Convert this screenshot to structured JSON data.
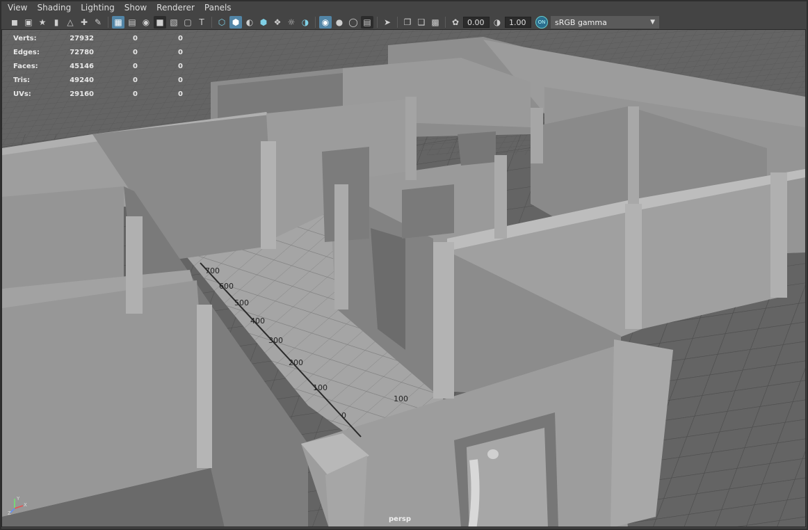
{
  "menu": [
    "View",
    "Shading",
    "Lighting",
    "Show",
    "Renderer",
    "Panels"
  ],
  "toolbar": {
    "icons": [
      "camera-icon",
      "camera-attributes-icon",
      "bookmark-icon",
      "image-plane-icon",
      "2d-pan-icon",
      "grease-pencil-icon",
      "grid-icon",
      "film-gate-icon",
      "resolution-gate-icon",
      "gate-mask-icon",
      "field-chart-icon",
      "safe-action-icon",
      "safe-title-icon",
      "wireframe-icon",
      "smooth-shade-icon",
      "default-material-icon",
      "textured-icon",
      "all-lights-icon",
      "shadows-icon",
      "ambient-occlusion-icon",
      "motion-blur-icon",
      "anti-aliasing-icon",
      "depth-of-field-icon",
      "isolate-select-icon",
      "xray-icon",
      "xray-joints-icon",
      "xray-components-icon",
      "exposure-icon",
      "gamma-icon"
    ],
    "exposure_value": "0.00",
    "gamma_value": "1.00",
    "color_management_badge": "ON",
    "view_transform": "sRGB gamma"
  },
  "hud": {
    "rows": [
      {
        "label": "Verts:",
        "value": "27932",
        "c2": "0",
        "c3": "0"
      },
      {
        "label": "Edges:",
        "value": "72780",
        "c2": "0",
        "c3": "0"
      },
      {
        "label": "Faces:",
        "value": "45146",
        "c2": "0",
        "c3": "0"
      },
      {
        "label": "Tris:",
        "value": "49240",
        "c2": "0",
        "c3": "0"
      },
      {
        "label": "UVs:",
        "value": "29160",
        "c2": "0",
        "c3": "0"
      }
    ]
  },
  "scene": {
    "ruler_ticks": [
      "700",
      "600",
      "500",
      "400",
      "300",
      "200",
      "100",
      "0"
    ],
    "ruler_cross_tick": "100"
  },
  "camera_label": "persp",
  "axis": {
    "y": "Y",
    "x": "X",
    "z": "Z"
  },
  "colors": {
    "ui_bg": "#444444",
    "viewport_bg": "#646464",
    "wall_light": "#9a9a9a",
    "wall_mid": "#8a8a8a",
    "wall_dark": "#6e6e6e",
    "floor": "#a3a3a3",
    "accent": "#5285a6"
  }
}
